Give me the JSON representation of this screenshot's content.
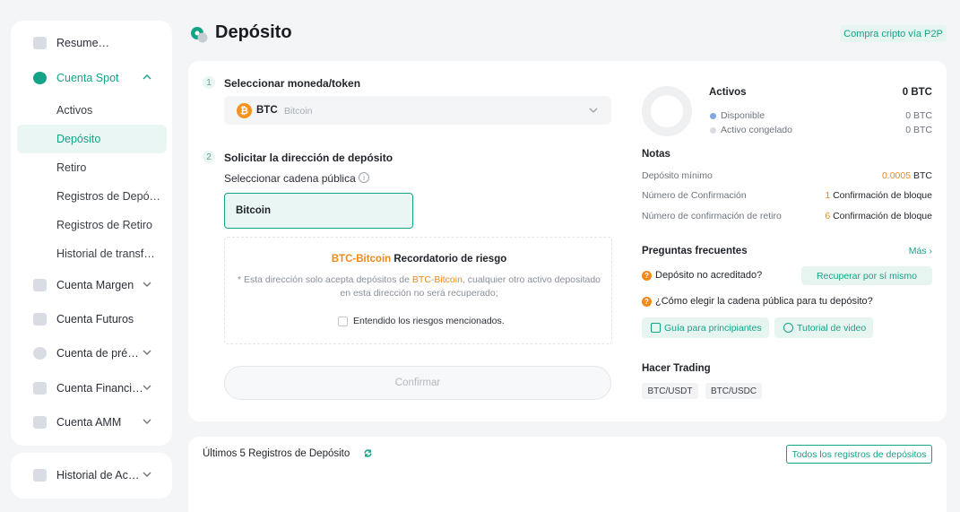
{
  "sidebar": {
    "items": [
      {
        "label": "Resume…"
      },
      {
        "label": "Cuenta Spot"
      },
      {
        "label": "Activos"
      },
      {
        "label": "Depósito"
      },
      {
        "label": "Retiro"
      },
      {
        "label": "Registros de Depó…"
      },
      {
        "label": "Registros de Retiro"
      },
      {
        "label": "Historial de transf…"
      },
      {
        "label": "Cuenta Margen"
      },
      {
        "label": "Cuenta Futuros"
      },
      {
        "label": "Cuenta de pré…"
      },
      {
        "label": "Cuenta Financi…"
      },
      {
        "label": "Cuenta AMM"
      }
    ],
    "history": {
      "label": "Historial de Ac…"
    }
  },
  "header": {
    "title": "Depósito",
    "p2p_label": "Compra cripto vía P2P"
  },
  "steps": {
    "step1": {
      "num": "1",
      "title": "Seleccionar moneda/token"
    },
    "step2": {
      "num": "2",
      "title": "Solicitar la dirección de depósito"
    }
  },
  "coin": {
    "symbol": "BTC",
    "name": "Bitcoin",
    "logo": "₿"
  },
  "chain": {
    "label": "Seleccionar cadena pública",
    "selected": "Bitcoin"
  },
  "risk": {
    "title_highlight": "BTC-Bitcoin",
    "title_rest": " Recordatorio de riesgo",
    "text_before": "* Esta dirección solo acepta depósitos de ",
    "text_highlight": "BTC-Bitcoin",
    "text_after": ", cualquier otro activo depositado en esta dirección no será recuperado;",
    "checkbox_label": "Entendido los riesgos mencionados."
  },
  "confirm_label": "Confirmar",
  "assets": {
    "title": "Activos",
    "total": "0 BTC",
    "available_label": "Disponible",
    "available_value": "0 BTC",
    "frozen_label": "Activo congelado",
    "frozen_value": "0 BTC",
    "available_color": "#7fa7e0",
    "frozen_color": "#d9dde3"
  },
  "notes": {
    "title": "Notas",
    "min_label": "Depósito mínimo",
    "min_value": "0.0005",
    "min_unit": " BTC",
    "conf_label": "Número de Confirmación",
    "conf_value": "1",
    "conf_unit": " Confirmación de bloque",
    "withdraw_label": "Número de confirmación de retiro",
    "withdraw_value": "6",
    "withdraw_unit": " Confirmación de bloque"
  },
  "faq": {
    "title": "Preguntas frecuentes",
    "more": "Más",
    "q1": "Depósito no acreditado?",
    "recover": "Recuperar por sí mismo",
    "q2": "¿Cómo elegir la cadena pública para tu depósito?",
    "guide": "Guía para principiantes",
    "video": "Tutorial de video"
  },
  "trading": {
    "title": "Hacer Trading",
    "pairs": [
      "BTC/USDT",
      "BTC/USDC"
    ]
  },
  "records": {
    "title": "Últimos 5 Registros de Depósito",
    "all_label": "Todos los registros de depósitos"
  }
}
